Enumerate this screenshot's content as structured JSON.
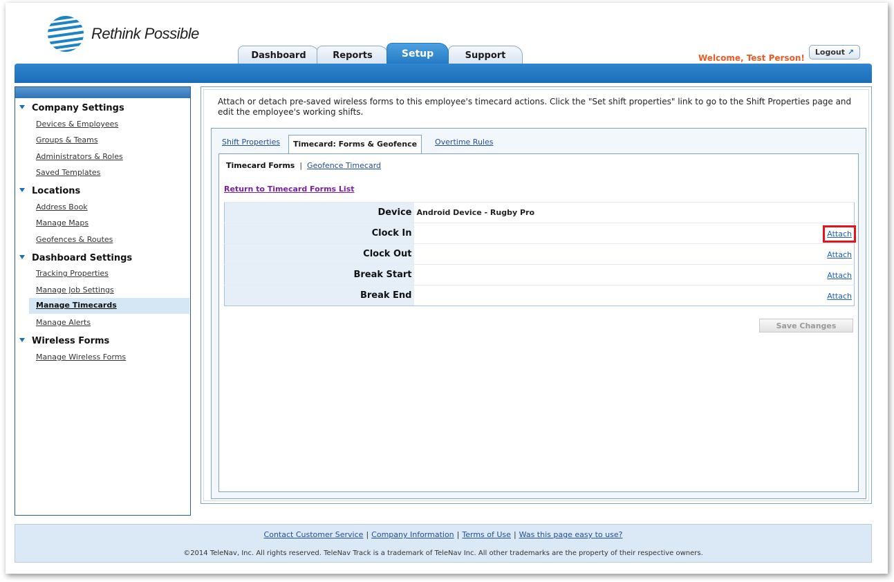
{
  "brand": {
    "tagline": "Rethink Possible"
  },
  "nav": {
    "tabs": [
      {
        "label": "Dashboard"
      },
      {
        "label": "Reports"
      },
      {
        "label": "Setup"
      },
      {
        "label": "Support"
      }
    ],
    "active_tab": "Setup",
    "welcome": "Welcome, Test Person!",
    "logout": "Logout"
  },
  "sidebar": {
    "sections": [
      {
        "title": "Company Settings",
        "items": [
          "Devices & Employees",
          "Groups & Teams",
          "Administrators & Roles",
          "Saved Templates"
        ]
      },
      {
        "title": "Locations",
        "items": [
          "Address Book",
          "Manage Maps",
          "Geofences & Routes"
        ]
      },
      {
        "title": "Dashboard Settings",
        "items": [
          "Tracking Properties",
          "Manage Job Settings",
          "Manage Timecards",
          "Manage Alerts"
        ]
      },
      {
        "title": "Wireless Forms",
        "items": [
          "Manage Wireless Forms"
        ]
      }
    ],
    "selected_item": "Manage Timecards"
  },
  "main": {
    "description": "Attach or detach pre-saved wireless forms to this employee's timecard actions. Click the \"Set shift properties\" link to go to the Shift Properties page and edit the employee's working shifts.",
    "tabs": [
      {
        "label": "Shift Properties"
      },
      {
        "label": "Timecard: Forms & Geofence"
      },
      {
        "label": "Overtime Rules"
      }
    ],
    "active_tab": "Timecard: Forms & Geofence",
    "subtabs": {
      "current": "Timecard Forms",
      "separator": "|",
      "other": "Geofence Timecard"
    },
    "return_link": "Return to Timecard Forms List",
    "form_table": {
      "device_label": "Device",
      "device_value": "Android Device - Rugby Pro",
      "rows": [
        {
          "label": "Clock In",
          "action": "Attach",
          "highlighted": true
        },
        {
          "label": "Clock Out",
          "action": "Attach"
        },
        {
          "label": "Break Start",
          "action": "Attach"
        },
        {
          "label": "Break End",
          "action": "Attach"
        }
      ]
    },
    "save_button": "Save Changes"
  },
  "footer": {
    "links": [
      "Contact Customer Service",
      "Company Information",
      "Terms of Use",
      "Was this page easy to use?"
    ],
    "separator": "|",
    "copyright": "©2014 TeleNav, Inc. All rights reserved. TeleNav Track is a trademark of TeleNav Inc. All other trademarks are the property of their respective owners."
  },
  "colors": {
    "brand_blue": "#1d6fbe",
    "welcome_orange": "#f15a22",
    "highlight_red": "#e5141c"
  }
}
